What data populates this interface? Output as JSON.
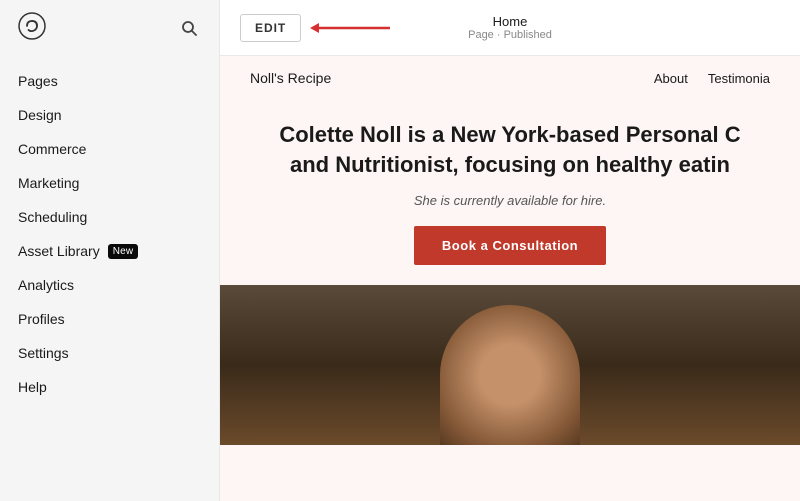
{
  "sidebar": {
    "logo_alt": "Squarespace",
    "items": [
      {
        "id": "pages",
        "label": "Pages",
        "badge": null
      },
      {
        "id": "design",
        "label": "Design",
        "badge": null
      },
      {
        "id": "commerce",
        "label": "Commerce",
        "badge": null
      },
      {
        "id": "marketing",
        "label": "Marketing",
        "badge": null
      },
      {
        "id": "scheduling",
        "label": "Scheduling",
        "badge": null
      },
      {
        "id": "asset-library",
        "label": "Asset Library",
        "badge": "New"
      },
      {
        "id": "analytics",
        "label": "Analytics",
        "badge": null
      },
      {
        "id": "profiles",
        "label": "Profiles",
        "badge": null
      },
      {
        "id": "settings",
        "label": "Settings",
        "badge": null
      },
      {
        "id": "help",
        "label": "Help",
        "badge": null
      }
    ]
  },
  "topbar": {
    "edit_label": "EDIT",
    "page_title": "Home",
    "page_subtitle": "Page · Published"
  },
  "preview": {
    "site_name": "Noll's Recipe",
    "nav_items": [
      "About",
      "Testimonia"
    ],
    "hero_title": "Colette Noll is a New York-based Personal C\nand Nutritionist, focusing on healthy eatin",
    "hero_subtitle": "She is currently available for hire.",
    "cta_label": "Book a Consultation"
  }
}
